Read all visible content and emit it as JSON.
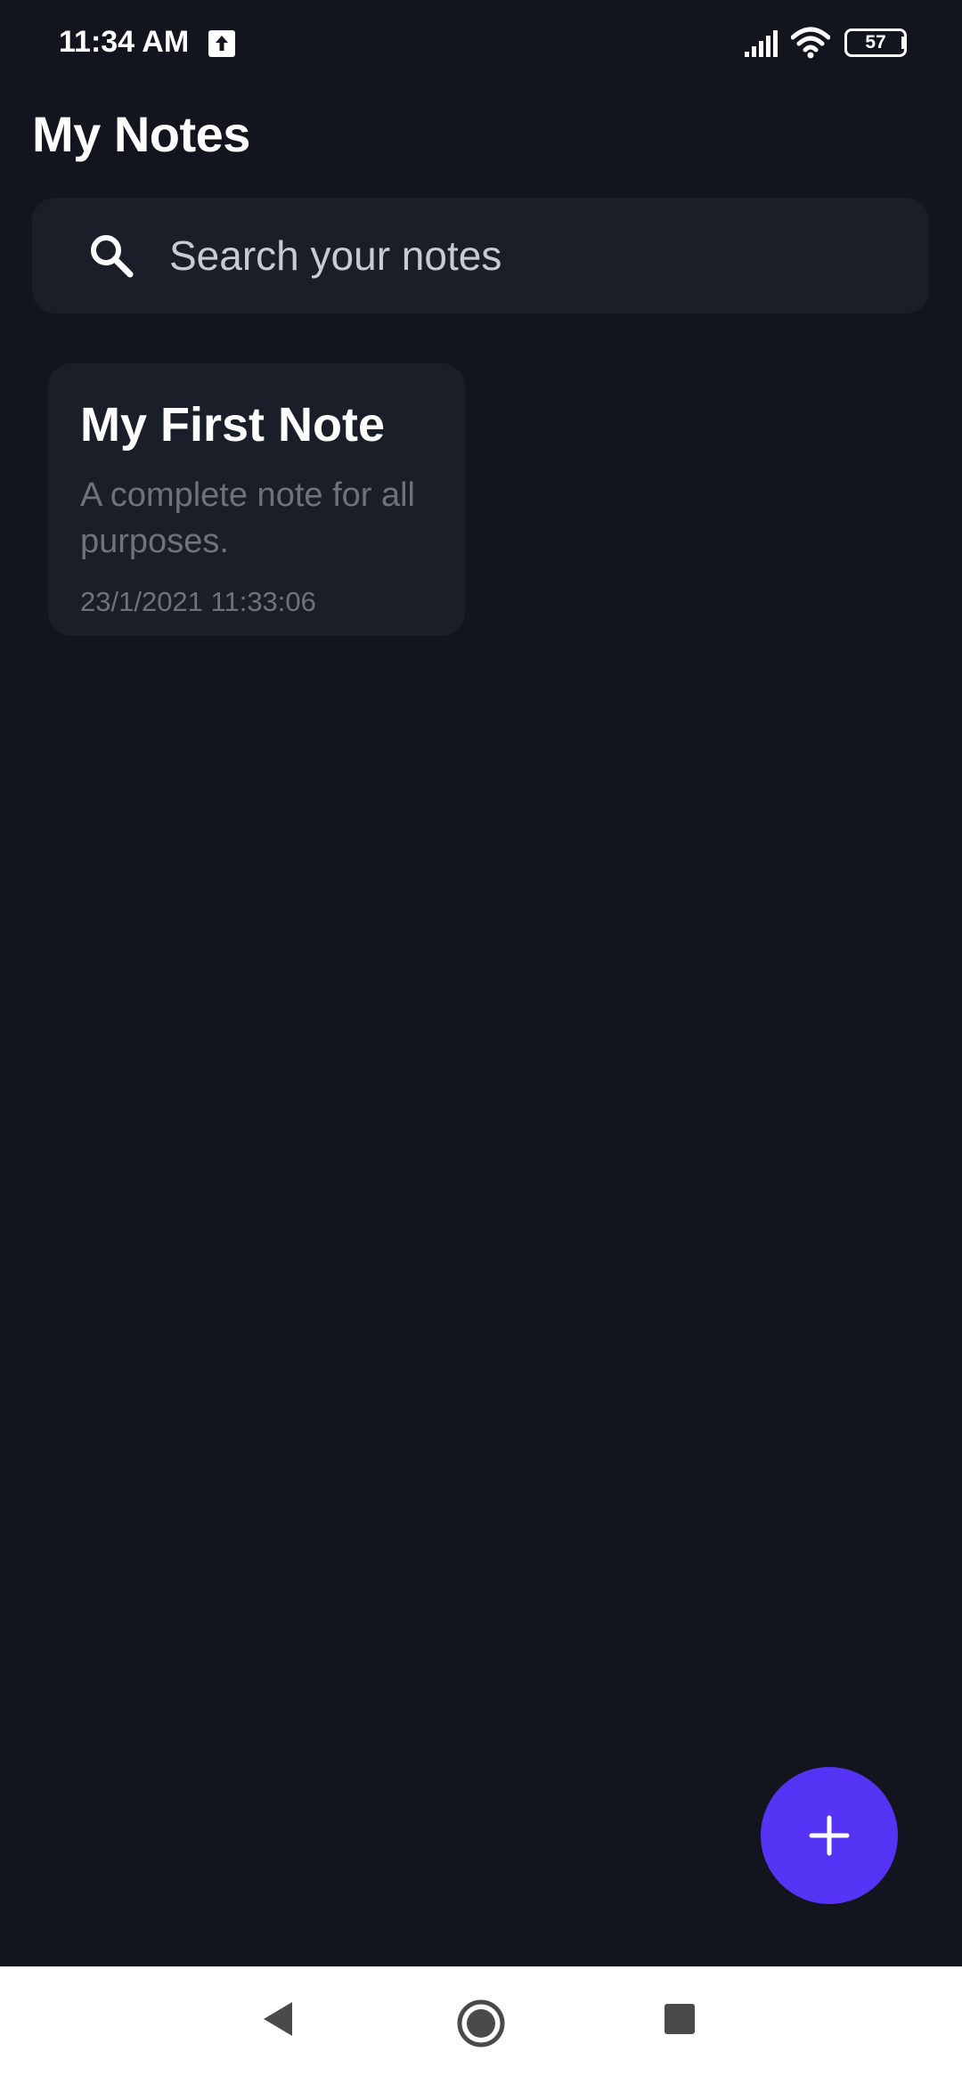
{
  "status_bar": {
    "time": "11:34 AM",
    "battery": "57"
  },
  "header": {
    "title": "My Notes"
  },
  "search": {
    "placeholder": "Search your notes",
    "value": ""
  },
  "notes": [
    {
      "title": "My First Note",
      "body": "A complete note for all purposes.",
      "date": "23/1/2021 11:33:06"
    }
  ],
  "icons": {
    "upload": "upload-icon",
    "signal": "signal-icon",
    "wifi": "wifi-icon",
    "battery": "battery-icon",
    "search": "search-icon",
    "add": "plus-icon",
    "back": "back-icon",
    "home": "home-icon",
    "recents": "recents-icon"
  },
  "colors": {
    "background": "#12151e",
    "surface": "#1a1e28",
    "accent": "#5534f5",
    "muted_text": "#6e727c"
  }
}
